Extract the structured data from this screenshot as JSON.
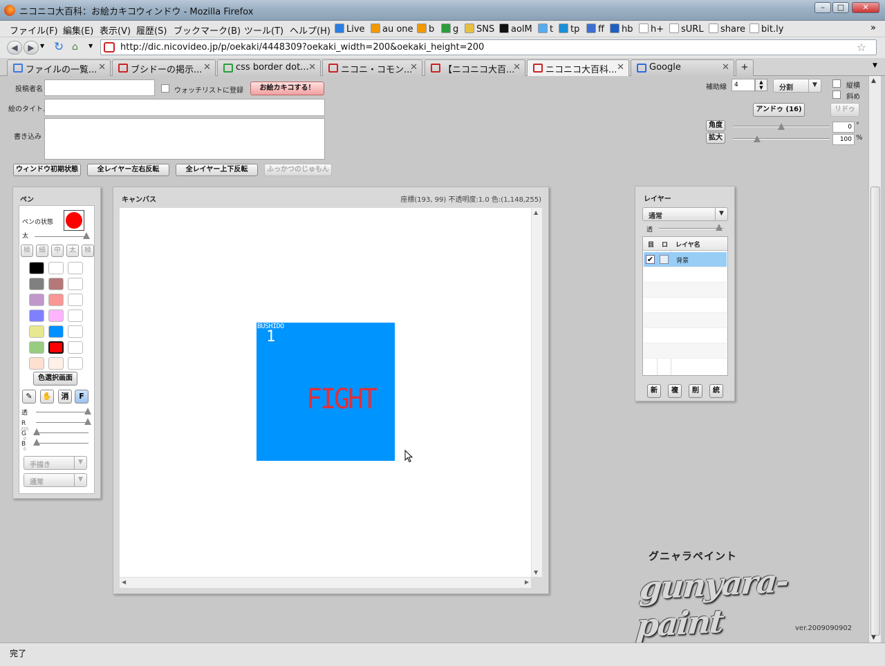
{
  "window": {
    "title": "ニコニコ大百科：お絵カキコウィンドウ - Mozilla Firefox",
    "min": "–",
    "max": "□",
    "close": "✕"
  },
  "menu": [
    "ファイル(F)",
    "編集(E)",
    "表示(V)",
    "履歴(S)",
    "ブックマーク(B)",
    "ツール(T)",
    "ヘルプ(H)"
  ],
  "bookmarks": [
    {
      "label": "Live",
      "color": "#2a7de1"
    },
    {
      "label": "au one",
      "color": "#f39800"
    },
    {
      "label": "b",
      "color": "#f39800"
    },
    {
      "label": "g",
      "color": "#2a9d3a"
    },
    {
      "label": "SNS",
      "color": "#e8c040"
    },
    {
      "label": "aolM",
      "color": "#111111"
    },
    {
      "label": "t",
      "color": "#55acee"
    },
    {
      "label": "tp",
      "color": "#1a8fd8"
    },
    {
      "label": "ff",
      "color": "#3c6fd1"
    },
    {
      "label": "hb",
      "color": "#1f5fbf"
    },
    {
      "label": "h+",
      "color": "#ffffff"
    },
    {
      "label": "sURL",
      "color": "#ffffff"
    },
    {
      "label": "share",
      "color": "#ffffff"
    },
    {
      "label": "bit.ly",
      "color": "#ffffff"
    }
  ],
  "nav": {
    "url": "http://dic.nicovideo.jp/p/oekaki/4448309?oekaki_width=200&oekaki_height=200"
  },
  "tabs": [
    {
      "label": "ファイルの一覧..."
    },
    {
      "label": "ブシドーの掲示..."
    },
    {
      "label": "css border dot..."
    },
    {
      "label": "ニコニ・コモン..."
    },
    {
      "label": "【ニコニコ大百..."
    },
    {
      "label": "ニコニコ大百科..."
    },
    {
      "label": "Google"
    }
  ],
  "form": {
    "poster_label": "投稿者名",
    "watchlist_label": "ウォッチリストに登録",
    "submit_label": "お絵カキコする！",
    "title_label": "絵のタイトル",
    "comment_label": "書き込み",
    "buttons": [
      "ウィンドウ初期状態",
      "全レイヤー左右反転",
      "全レイヤー上下反転",
      "ふっかつのじゅもん"
    ]
  },
  "tools_top": {
    "aux_label": "補助線",
    "aux_value": "4",
    "split_label": "分割",
    "vert_label": "縦横",
    "diag_label": "斜め",
    "undo_label": "アンドゥ (16)",
    "redo_label": "リドゥ",
    "angle_label": "角度",
    "angle_value": "0",
    "angle_unit": "°",
    "zoom_label": "拡大",
    "zoom_value": "100",
    "zoom_unit": "%",
    "angle_level": 0.5,
    "zoom_level": 0.25
  },
  "pen": {
    "title": "ペン",
    "state_label": "ペンの状態",
    "current_color": "#ff0000",
    "thick_label": "太",
    "sizes": [
      "極",
      "細",
      "中",
      "太",
      "極"
    ],
    "colors": [
      [
        "#000000",
        "#ffffff",
        "#ffffff"
      ],
      [
        "#808080",
        "#b47878",
        "#ffffff"
      ],
      [
        "#c098cc",
        "#fa9696",
        "#ffffff"
      ],
      [
        "#8080ff",
        "#ffb4ff",
        "#ffffff"
      ],
      [
        "#e8e890",
        "#0090ff",
        "#ffffff"
      ],
      [
        "#98cc80",
        "#ff0000",
        "#ffffff"
      ],
      [
        "#ffe0d0",
        "#fff0e8",
        "#ffffff"
      ]
    ],
    "color_select_label": "色選択画面",
    "tools": [
      "✎",
      "✋",
      "消",
      "F"
    ],
    "alpha_label": "透",
    "r_label": "R",
    "r_value": "255",
    "g_label": "G",
    "g_value": "0",
    "b_label": "B",
    "b_value": "0",
    "mode1": "手描き",
    "mode2": "通常"
  },
  "canvas": {
    "title": "キャンバス",
    "status": "座標(193, 99) 不透明度:1.0 色:(1,148,255)",
    "art_bg": "#0094ff",
    "text1": "BUSHIDO",
    "text2": "1",
    "text3": "FIGHT"
  },
  "layer": {
    "title": "レイヤー",
    "mode": "通常",
    "alpha_label": "透",
    "col_eye": "目",
    "col_lock": "ロ",
    "col_name": "レイヤ名",
    "rows": [
      {
        "name": "背景",
        "visible": true
      }
    ],
    "buttons": [
      "新",
      "複",
      "削",
      "統"
    ]
  },
  "logo": {
    "kana": "グニャラペイント",
    "name": "gunyara-paint",
    "version": "ver.2009090902"
  },
  "status": {
    "text": "完了"
  }
}
